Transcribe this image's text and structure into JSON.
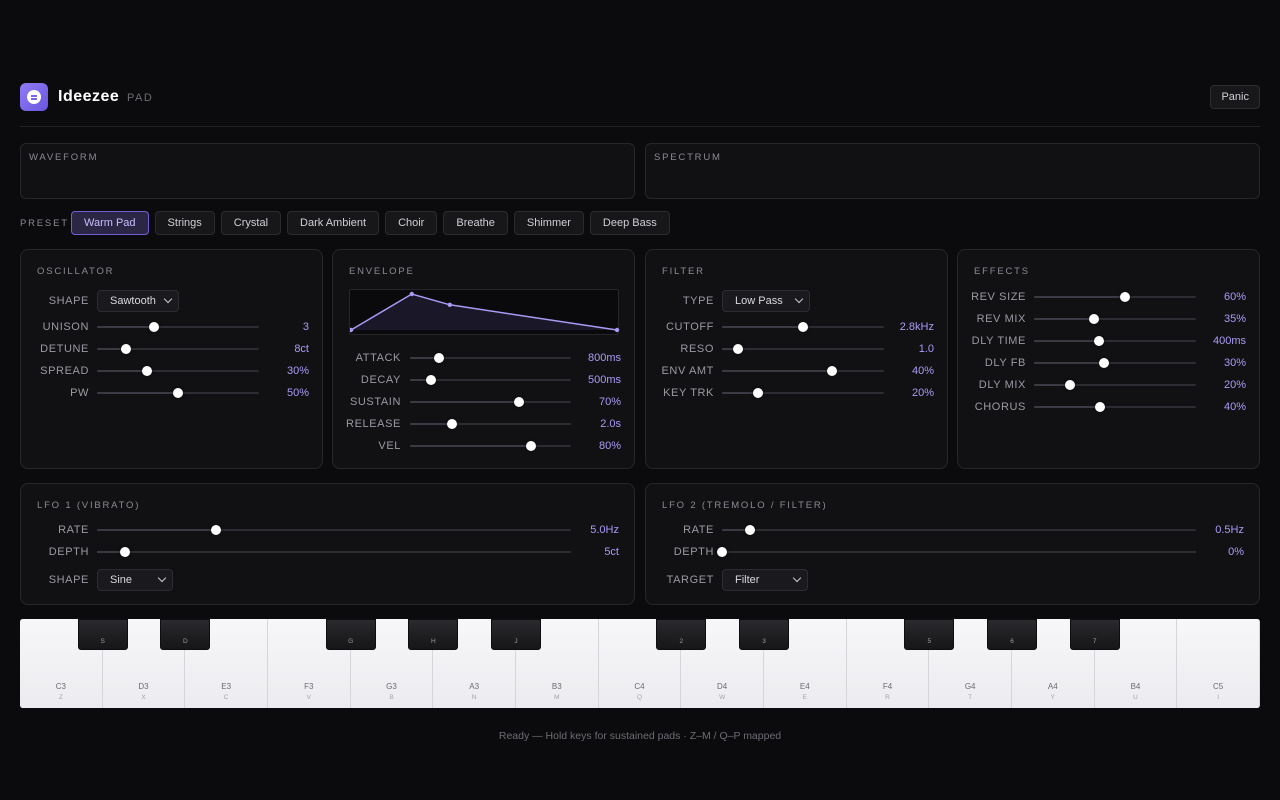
{
  "app": {
    "title": "Ideezee",
    "subtitle": "PAD",
    "panic_label": "Panic"
  },
  "viz": {
    "waveform_label": "WAVEFORM",
    "spectrum_label": "SPECTRUM"
  },
  "presets": {
    "label": "PRESET",
    "items": [
      "Warm Pad",
      "Strings",
      "Crystal",
      "Dark Ambient",
      "Choir",
      "Breathe",
      "Shimmer",
      "Deep Bass"
    ],
    "active": "Warm Pad"
  },
  "oscillator": {
    "title": "OSCILLATOR",
    "shape_label": "SHAPE",
    "shape_value": "Sawtooth",
    "params": [
      {
        "label": "UNISON",
        "value": "3",
        "level": 0.35
      },
      {
        "label": "DETUNE",
        "value": "8ct",
        "level": 0.18
      },
      {
        "label": "SPREAD",
        "value": "30%",
        "level": 0.31
      },
      {
        "label": "PW",
        "value": "50%",
        "level": 0.5
      }
    ]
  },
  "envelope": {
    "title": "ENVELOPE",
    "params": [
      {
        "label": "ATTACK",
        "value": "800ms",
        "level": 0.18
      },
      {
        "label": "DECAY",
        "value": "500ms",
        "level": 0.13
      },
      {
        "label": "SUSTAIN",
        "value": "70%",
        "level": 0.68
      },
      {
        "label": "RELEASE",
        "value": "2.0s",
        "level": 0.26
      },
      {
        "label": "VEL",
        "value": "80%",
        "level": 0.75
      }
    ]
  },
  "filter": {
    "title": "FILTER",
    "type_label": "TYPE",
    "type_value": "Low Pass",
    "params": [
      {
        "label": "CUTOFF",
        "value": "2.8kHz",
        "level": 0.5
      },
      {
        "label": "RESO",
        "value": "1.0",
        "level": 0.1
      },
      {
        "label": "ENV AMT",
        "value": "40%",
        "level": 0.68
      },
      {
        "label": "KEY TRK",
        "value": "20%",
        "level": 0.22
      }
    ]
  },
  "effects": {
    "title": "EFFECTS",
    "params": [
      {
        "label": "REV SIZE",
        "value": "60%",
        "level": 0.56
      },
      {
        "label": "REV MIX",
        "value": "35%",
        "level": 0.37
      },
      {
        "label": "DLY TIME",
        "value": "400ms",
        "level": 0.4
      },
      {
        "label": "DLY FB",
        "value": "30%",
        "level": 0.43
      },
      {
        "label": "DLY MIX",
        "value": "20%",
        "level": 0.22
      },
      {
        "label": "CHORUS",
        "value": "40%",
        "level": 0.41
      }
    ]
  },
  "lfo1": {
    "title": "LFO 1 (VIBRATO)",
    "params": [
      {
        "label": "RATE",
        "value": "5.0Hz",
        "level": 0.25
      },
      {
        "label": "DEPTH",
        "value": "5ct",
        "level": 0.06
      }
    ],
    "shape_label": "SHAPE",
    "shape_value": "Sine"
  },
  "lfo2": {
    "title": "LFO 2 (TREMOLO / FILTER)",
    "params": [
      {
        "label": "RATE",
        "value": "0.5Hz",
        "level": 0.06
      },
      {
        "label": "DEPTH",
        "value": "0%",
        "level": 0.0
      }
    ],
    "target_label": "TARGET",
    "target_value": "Filter"
  },
  "keyboard": {
    "white_keys": [
      {
        "note": "C3",
        "key": "Z"
      },
      {
        "note": "D3",
        "key": "X"
      },
      {
        "note": "E3",
        "key": "C"
      },
      {
        "note": "F3",
        "key": "V"
      },
      {
        "note": "G3",
        "key": "B"
      },
      {
        "note": "A3",
        "key": "N"
      },
      {
        "note": "B3",
        "key": "M"
      },
      {
        "note": "C4",
        "key": "Q"
      },
      {
        "note": "D4",
        "key": "W"
      },
      {
        "note": "E4",
        "key": "E"
      },
      {
        "note": "F4",
        "key": "R"
      },
      {
        "note": "G4",
        "key": "T"
      },
      {
        "note": "A4",
        "key": "Y"
      },
      {
        "note": "B4",
        "key": "U"
      },
      {
        "note": "C5",
        "key": "I"
      }
    ],
    "black_keys": [
      {
        "key": "S",
        "after": 0
      },
      {
        "key": "D",
        "after": 1
      },
      {
        "key": "G",
        "after": 3
      },
      {
        "key": "H",
        "after": 4
      },
      {
        "key": "J",
        "after": 5
      },
      {
        "key": "2",
        "after": 7
      },
      {
        "key": "3",
        "after": 8
      },
      {
        "key": "5",
        "after": 10
      },
      {
        "key": "6",
        "after": 11
      },
      {
        "key": "7",
        "after": 12
      }
    ]
  },
  "status": "Ready — Hold keys for sustained pads · Z–M / Q–P mapped",
  "colors": {
    "accent": "#a99bf5",
    "active_preset_bg": "#2a2644",
    "active_preset_border": "#6f5fd6",
    "panel_bg": "#111114",
    "page_bg": "#0b0b0d"
  },
  "envelope_curve": {
    "attack": 0.8,
    "decay": 0.5,
    "sustain": 0.7,
    "release": 2.0
  }
}
